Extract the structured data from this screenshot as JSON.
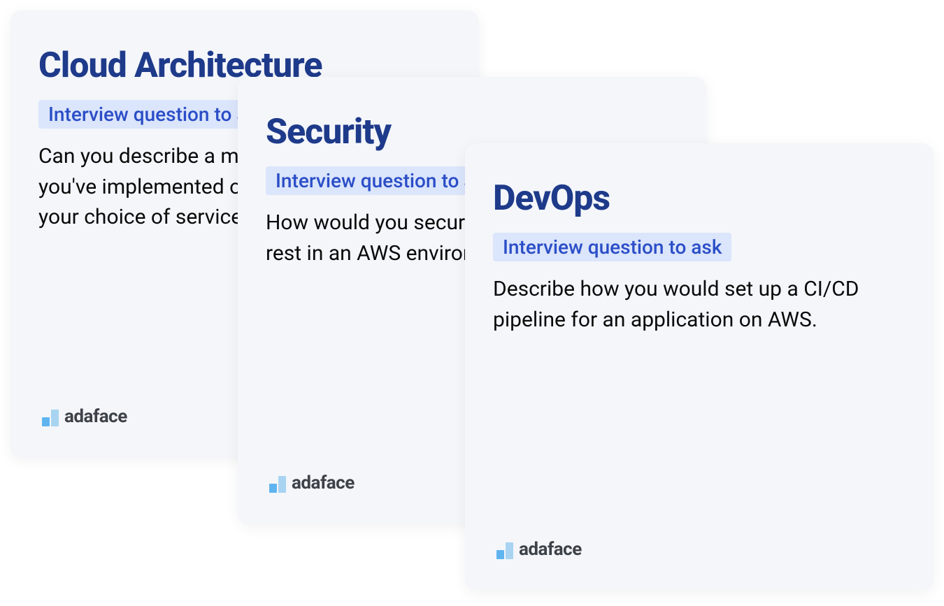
{
  "cards": [
    {
      "title": "Cloud Architecture",
      "badge": "Interview question to ask",
      "question": "Can you describe a multi-tier architecture you've implemented on AWS and explain your choice of services?"
    },
    {
      "title": "Security",
      "badge": "Interview question to ask",
      "question": "How would you secure data in transit and at rest in an AWS environment?"
    },
    {
      "title": "DevOps",
      "badge": "Interview question to ask",
      "question": "Describe how you would set up a CI/CD pipeline for an application on AWS."
    }
  ],
  "brand": "adaface"
}
